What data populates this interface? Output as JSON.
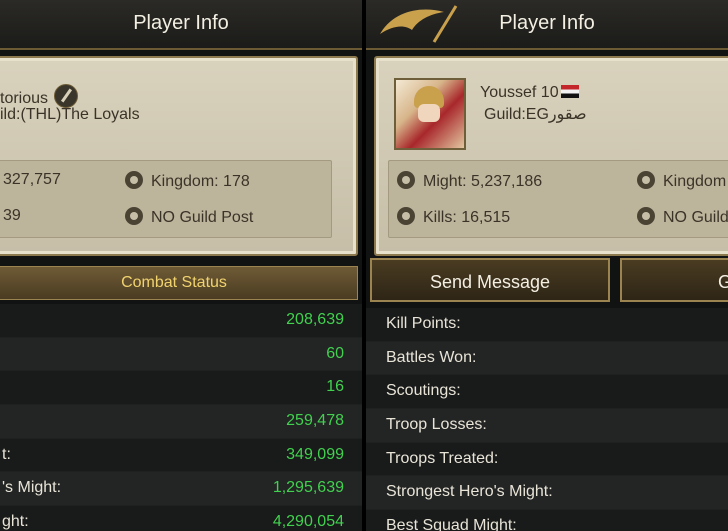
{
  "left": {
    "title": "Player Info",
    "name": "torious",
    "guild": "ild:(THL)The Loyals",
    "might": "327,757",
    "kingdom": "Kingdom: 178",
    "kills": "39",
    "guild_post": "NO Guild Post",
    "combat_status": "Combat Status",
    "rows": [
      {
        "label": "",
        "value": "208,639"
      },
      {
        "label": "",
        "value": "60"
      },
      {
        "label": "",
        "value": "16"
      },
      {
        "label": "",
        "value": "259,478"
      },
      {
        "label": "t:",
        "value": "349,099"
      },
      {
        "label": "'s Might:",
        "value": "1,295,639"
      },
      {
        "label": "ght:",
        "value": "4,290,054"
      }
    ]
  },
  "right": {
    "title": "Player Info",
    "name": "Youssef 10",
    "guild": "Guild:EGصقور",
    "might": "Might: 5,237,186",
    "kingdom": "Kingdom",
    "kills": "Kills: 16,515",
    "guild_post": "NO Guild",
    "send_message": "Send Message",
    "second_button": "G",
    "rows": [
      {
        "label": "Kill Points:"
      },
      {
        "label": "Battles Won:"
      },
      {
        "label": "Scoutings:"
      },
      {
        "label": "Troop Losses:"
      },
      {
        "label": "Troops Treated:"
      },
      {
        "label": "Strongest Hero's Might:"
      },
      {
        "label": "Best Squad Might:"
      }
    ]
  },
  "icons": {
    "might": "crossed-swords-icon",
    "kingdom": "helmet-icon",
    "kills": "skull-icon",
    "guild_post": "guild-crest-icon",
    "flag": "egypt-flag-icon",
    "feather": "feather-icon",
    "emblem": "eagle-emblem-icon"
  },
  "colors": {
    "value_green": "#41d14f",
    "combat_gold": "#f0d36f",
    "card_bg": "#d9d2bd"
  }
}
